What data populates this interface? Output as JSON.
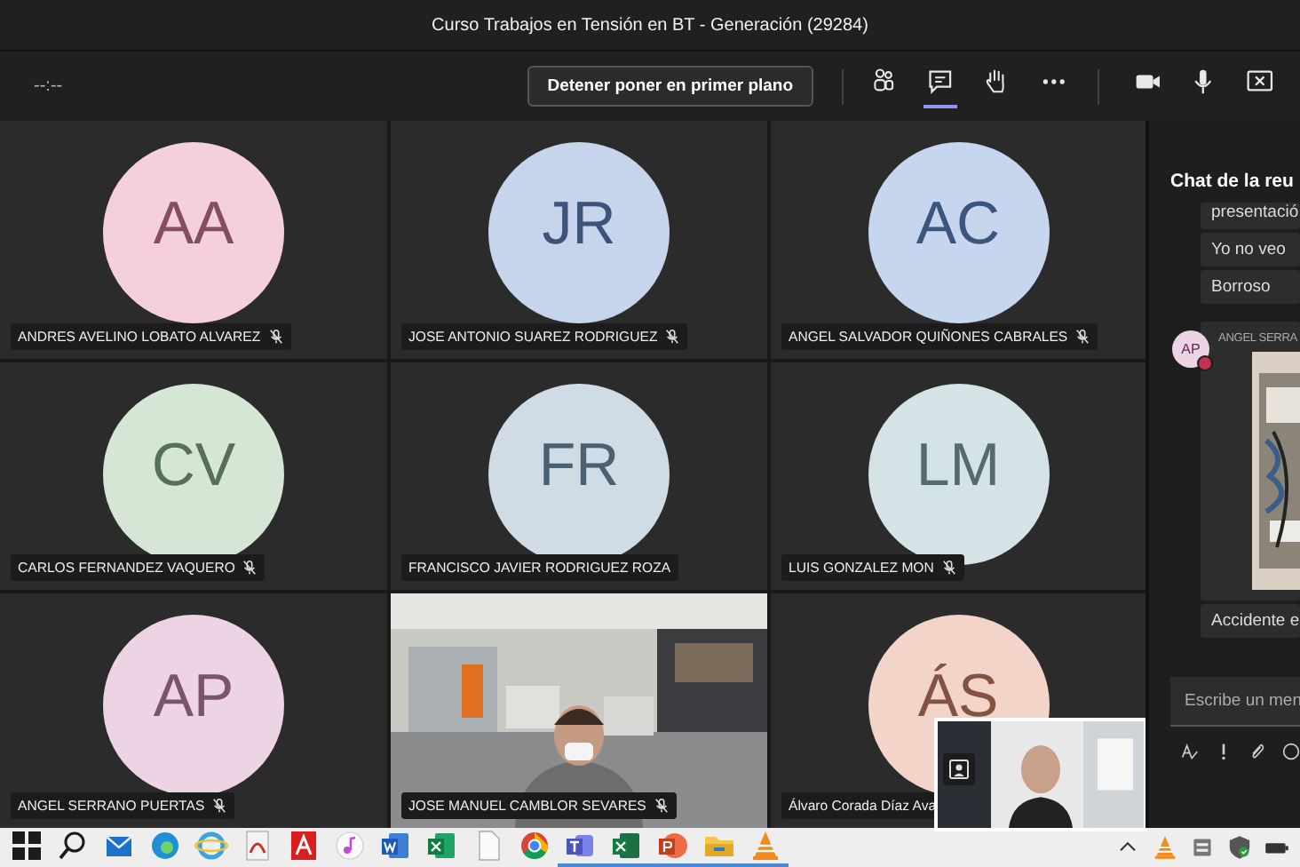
{
  "window": {
    "title": "Curso Trabajos en Tensión en BT - Generación (29284)"
  },
  "toolbar": {
    "timer": "--:--",
    "spotlight_button": "Detener poner en primer plano",
    "buttons": [
      {
        "kind": "people",
        "selected": false
      },
      {
        "kind": "chat",
        "selected": true
      },
      {
        "kind": "hand",
        "selected": false
      },
      {
        "kind": "more",
        "selected": false
      },
      {
        "kind": "camera",
        "selected": false
      },
      {
        "kind": "mic",
        "selected": false
      },
      {
        "kind": "share",
        "selected": false
      }
    ]
  },
  "participants": [
    {
      "kind": "avatar",
      "initials": "AA",
      "name": "ANDRES AVELINO LOBATO ALVAREZ",
      "muted": true,
      "color": "#f3d0dc"
    },
    {
      "kind": "avatar",
      "initials": "JR",
      "name": "JOSE ANTONIO SUAREZ RODRIGUEZ",
      "muted": true,
      "color": "#c6d4ec"
    },
    {
      "kind": "avatar",
      "initials": "AC",
      "name": "ANGEL SALVADOR QUIÑONES CABRALES",
      "muted": true,
      "color": "#c5d6ee"
    },
    {
      "kind": "avatar",
      "initials": "CV",
      "name": "CARLOS FERNANDEZ VAQUERO",
      "muted": true,
      "color": "#d5e6d5"
    },
    {
      "kind": "avatar",
      "initials": "FR",
      "name": "FRANCISCO JAVIER RODRIGUEZ ROZA",
      "muted": false,
      "color": "#cfdce6"
    },
    {
      "kind": "avatar",
      "initials": "LM",
      "name": "LUIS GONZALEZ MON",
      "muted": true,
      "color": "#d4e3e6"
    },
    {
      "kind": "avatar",
      "initials": "AP",
      "name": "ANGEL SERRANO PUERTAS",
      "muted": true,
      "color": "#ecd4e4"
    },
    {
      "kind": "video",
      "name": "JOSE MANUEL CAMBLOR SEVARES",
      "muted": true
    },
    {
      "kind": "avatar",
      "initials": "ÁS",
      "name": "Álvaro Corada Díaz Ava",
      "muted": false,
      "color": "#f2d4c9"
    }
  ],
  "chat": {
    "title": "Chat de la reu",
    "messages": [
      {
        "kind": "text",
        "text": "presentació"
      },
      {
        "kind": "text",
        "text": "Yo no veo"
      },
      {
        "kind": "text",
        "text": "Borroso"
      },
      {
        "initials": "AP",
        "sender": "ANGEL SERRA"
      },
      {
        "kind": "text",
        "text": "Accidente e"
      }
    ],
    "compose": {
      "placeholder": "Escribe un men"
    }
  },
  "taskbar": {
    "apps": [
      {
        "kind": "start",
        "running": false
      },
      {
        "kind": "search",
        "running": false
      },
      {
        "kind": "mail",
        "running": false
      },
      {
        "kind": "edge",
        "running": false
      },
      {
        "kind": "ie",
        "running": false
      },
      {
        "kind": "pdf",
        "running": false
      },
      {
        "kind": "acrobat",
        "running": false
      },
      {
        "kind": "music",
        "running": false
      },
      {
        "kind": "word",
        "running": false
      },
      {
        "kind": "excel",
        "running": false
      },
      {
        "kind": "file",
        "running": false
      },
      {
        "kind": "chrome",
        "running": false
      },
      {
        "kind": "teams",
        "running": true
      },
      {
        "kind": "project",
        "running": true
      },
      {
        "kind": "powerpoint",
        "running": true
      },
      {
        "kind": "folder",
        "running": true
      },
      {
        "kind": "vlc",
        "running": true
      }
    ],
    "tray": [
      {
        "kind": "chevron"
      },
      {
        "kind": "vlc"
      },
      {
        "kind": "device"
      },
      {
        "kind": "shield"
      },
      {
        "kind": "battery"
      }
    ]
  }
}
